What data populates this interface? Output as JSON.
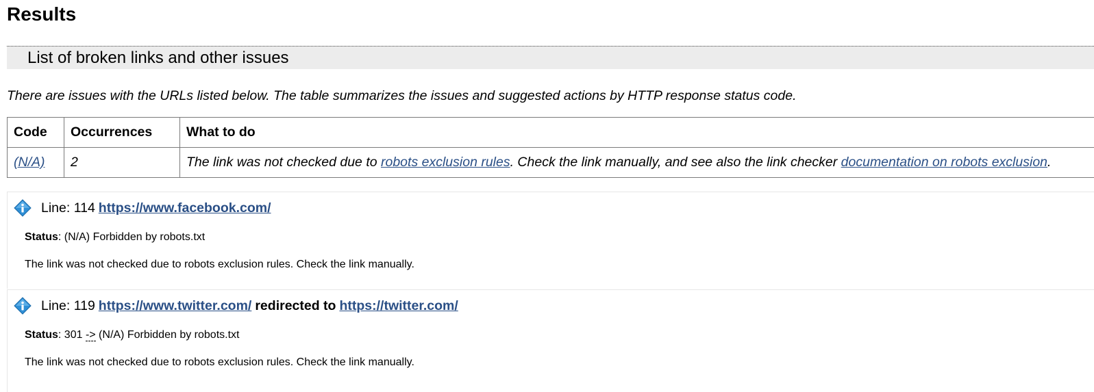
{
  "page": {
    "heading": "Results",
    "section_title": "List of broken links and other issues",
    "intro": "There are issues with the URLs listed below. The table summarizes the issues and suggested actions by HTTP response status code."
  },
  "summary_table": {
    "headers": {
      "code": "Code",
      "occurrences": "Occurrences",
      "action": "What to do"
    },
    "rows": [
      {
        "code": "(N/A)",
        "occurrences": "2",
        "action_before": "The link was not checked due to ",
        "action_link1": "robots exclusion rules",
        "action_middle": ". Check the link manually, and see also the link checker ",
        "action_link2": "documentation on robots exclusion",
        "action_after": "."
      }
    ]
  },
  "issues": [
    {
      "icon": "info-icon",
      "line_label": "Line: 114",
      "url": "https://www.facebook.com/",
      "status_label": "Status",
      "status_text": ": (N/A) Forbidden by robots.txt",
      "note": "The link was not checked due to robots exclusion rules. Check the link manually."
    },
    {
      "icon": "info-icon",
      "line_label": "Line: 119",
      "url": "https://www.twitter.com/",
      "redirect_label": "redirected to",
      "redirect_url": "https://twitter.com/",
      "status_label": "Status",
      "status_code": ": 301 ",
      "status_arrow": "->",
      "status_text": " (N/A) Forbidden by robots.txt",
      "note": "The link was not checked due to robots exclusion rules. Check the link manually."
    }
  ],
  "colors": {
    "link": "#2a4f86",
    "band": "#ececec",
    "icon": "#2f8fd6"
  }
}
